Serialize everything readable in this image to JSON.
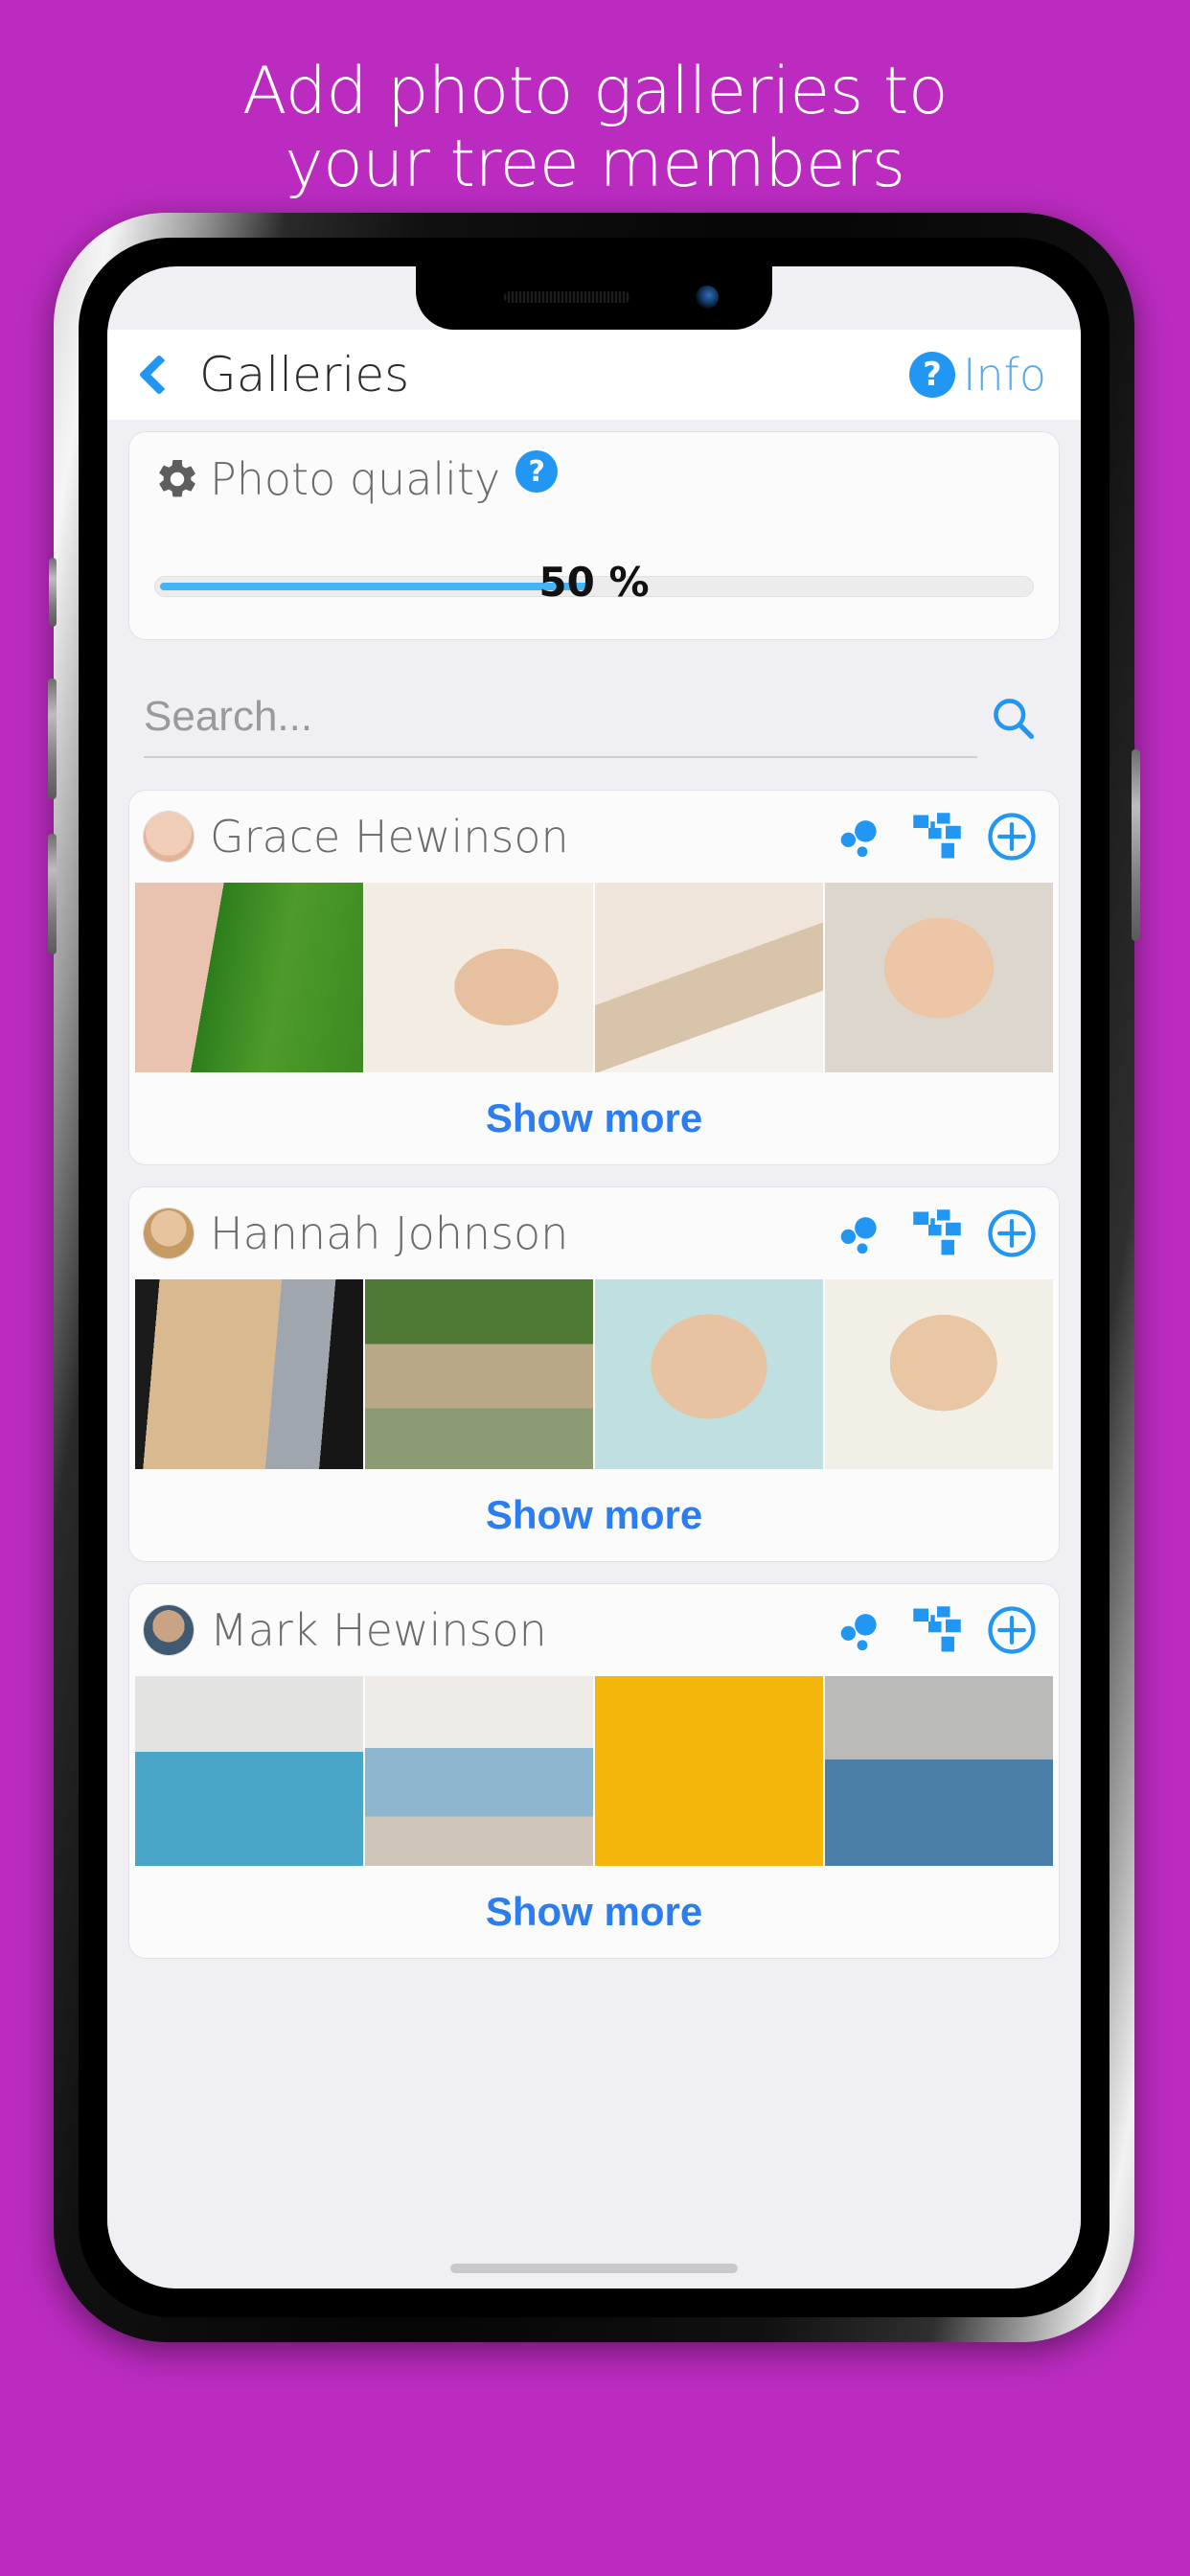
{
  "promo": {
    "line1": "Add photo galleries to",
    "line2": "your tree members",
    "background_color": "#BB2BC0",
    "text_color": "#FFFFFF"
  },
  "navbar": {
    "back_icon": "chevron-left-icon",
    "title": "Galleries",
    "info_icon": "question-mark-circle-icon",
    "info_label": "Info",
    "accent_color": "#2196F3"
  },
  "photo_quality": {
    "gear_icon": "gear-icon",
    "label": "Photo quality",
    "help_icon": "question-mark-circle-icon",
    "help_label": "?",
    "slider_value_text": "50 %",
    "slider_percent": 50,
    "slider_fill_color": "#43B4F5"
  },
  "search": {
    "placeholder": "Search...",
    "value": "",
    "icon": "search-icon"
  },
  "galleries": [
    {
      "name": "Grace Hewinson",
      "avatar_icon": "avatar-grace",
      "actions": [
        {
          "icon": "relations-bubbles-icon",
          "name": "relations-button"
        },
        {
          "icon": "family-tree-icon",
          "name": "tree-button"
        },
        {
          "icon": "plus-circle-icon",
          "name": "add-photo-button"
        }
      ],
      "photos": [
        "girl-with-puppy-on-grass",
        "smiling-girl-portrait",
        "child-sleeping-with-teddy",
        "girl-striped-shirt-portrait"
      ],
      "show_more_label": "Show more"
    },
    {
      "name": "Hannah Johnson",
      "avatar_icon": "avatar-hannah",
      "actions": [
        {
          "icon": "relations-bubbles-icon",
          "name": "relations-button"
        },
        {
          "icon": "family-tree-icon",
          "name": "tree-button"
        },
        {
          "icon": "plus-circle-icon",
          "name": "add-photo-button"
        }
      ],
      "photos": [
        "blonde-woman-dark-background",
        "woman-outdoors-path",
        "blonde-woman-bangs-portrait",
        "smiling-blonde-white-top"
      ],
      "show_more_label": "Show more"
    },
    {
      "name": "Mark Hewinson",
      "avatar_icon": "avatar-mark",
      "actions": [
        {
          "icon": "relations-bubbles-icon",
          "name": "relations-button"
        },
        {
          "icon": "family-tree-icon",
          "name": "tree-button"
        },
        {
          "icon": "plus-circle-icon",
          "name": "add-photo-button"
        }
      ],
      "photos": [
        "man-blue-polo-arms-crossed",
        "man-at-laptop",
        "man-yellow-background-phone",
        "man-blue-shirt-portrait"
      ],
      "show_more_label": "Show more"
    }
  ]
}
